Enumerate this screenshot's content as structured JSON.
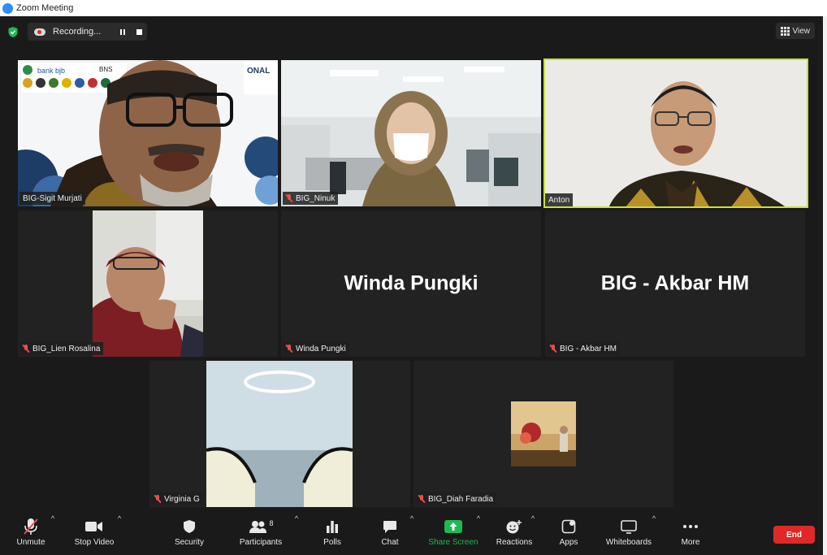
{
  "window": {
    "title": "Zoom Meeting"
  },
  "topbar": {
    "recording_label": "Recording...",
    "view_label": "View"
  },
  "tiles": [
    {
      "name": "BIG-Sigit Murjati",
      "muted": false
    },
    {
      "name": "BIG_Ninuk",
      "muted": true
    },
    {
      "name": "Anton",
      "muted": false,
      "active_speaker": true
    },
    {
      "name": "BIG_Lien Rosalina",
      "muted": true
    },
    {
      "name": "Winda Pungki",
      "muted": true,
      "big_name": "Winda Pungki"
    },
    {
      "name": "BIG - Akbar HM",
      "muted": true,
      "big_name": "BIG - Akbar HM"
    },
    {
      "name": "Virginia G",
      "muted": true
    },
    {
      "name": "BIG_Diah Faradia",
      "muted": true
    }
  ],
  "video_backdrop": {
    "sponsor_text_1": "bank bjb",
    "sponsor_text_2": "BNS",
    "banner_text": "ONAL"
  },
  "toolbar": {
    "unmute": "Unmute",
    "stop_video": "Stop Video",
    "security": "Security",
    "participants": "Participants",
    "participants_count": "8",
    "polls": "Polls",
    "chat": "Chat",
    "share_screen": "Share Screen",
    "reactions": "Reactions",
    "apps": "Apps",
    "whiteboards": "Whiteboards",
    "more": "More",
    "end": "End"
  },
  "colors": {
    "background": "#1a1a1a",
    "tile": "#222222",
    "active_speaker_border": "#c8e13a",
    "share_green": "#1db954",
    "end_red": "#e02828",
    "muted_red": "#e84d4d"
  }
}
